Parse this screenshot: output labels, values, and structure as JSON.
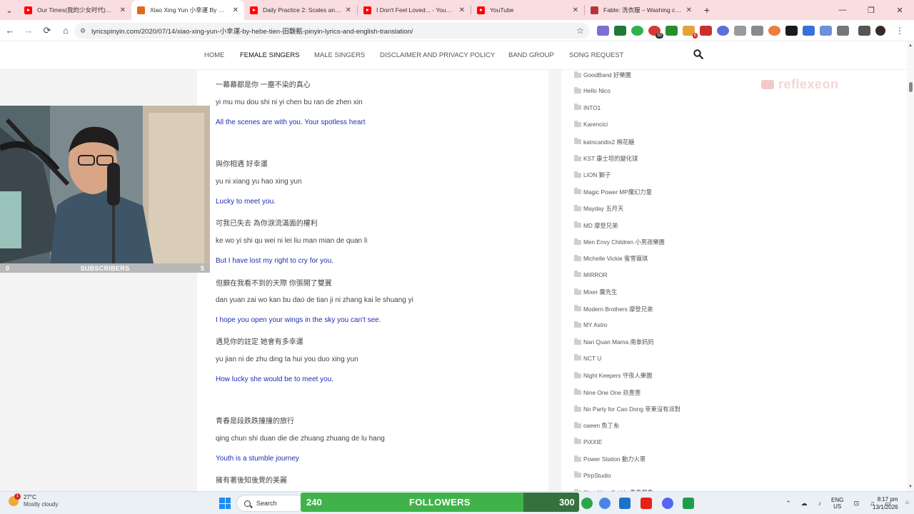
{
  "tabs": [
    {
      "title": "Our Times(我的少女时代)电影",
      "icon": "youtube-icon"
    },
    {
      "title": "Xiao Xing Yun 小幸運 By Hebe",
      "icon": "lyricspinyin-icon"
    },
    {
      "title": "Daily Practice 2: Scales and Inte",
      "icon": "youtube-icon"
    },
    {
      "title": "I Don't Feel Loved... - YouTube",
      "icon": "youtube-icon"
    },
    {
      "title": "YouTube",
      "icon": "youtube-icon"
    },
    {
      "title": "Fable: 洗衣服 – Washing clothe",
      "icon": "fable-icon"
    }
  ],
  "tab_close": "✕",
  "new_tab": "+",
  "window_controls": {
    "minimize": "—",
    "restore": "❐",
    "close": "✕"
  },
  "address": {
    "url": "lyricspinyin.com/2020/07/14/xiao-xing-yun-小幸運-by-hebe-tien-田馥甄-pinyin-lyrics-and-english-translation/"
  },
  "nav_buttons": {
    "back": "←",
    "forward": "→",
    "reload": "⟳",
    "home": "⌂"
  },
  "site_nav": {
    "items": [
      "HOME",
      "FEMALE SINGERS",
      "MALE SINGERS",
      "DISCLAIMER AND PRIVACY POLICY",
      "BAND GROUP",
      "SONG REQUEST"
    ]
  },
  "watermark": "reflexeon",
  "lyrics": [
    {
      "kind": "cn",
      "text": "一幕幕都是你 一塵不染的真心"
    },
    {
      "kind": "py",
      "text": "yi mu mu dou shi ni  yi chen bu ran de zhen xin"
    },
    {
      "kind": "en",
      "text": "All the scenes are with you. Your spotless heart"
    },
    {
      "kind": "cn",
      "text": "與你相遇 好幸運"
    },
    {
      "kind": "py",
      "text": "yu ni xiang yu  hao xing yun"
    },
    {
      "kind": "en",
      "text": "Lucky to meet you."
    },
    {
      "kind": "cn",
      "text": "可我已失去 為你淚流滿面的權利"
    },
    {
      "kind": "py",
      "text": "ke wo yi shi qu  wei ni lei liu man mian de quan li"
    },
    {
      "kind": "en",
      "text": "But I have lost my right to cry for you."
    },
    {
      "kind": "cn",
      "text": "但願在我看不到的天際 你張開了雙翼"
    },
    {
      "kind": "py",
      "text": "dan yuan zai wo kan bu dao de tian ji  ni zhang kai le shuang yi"
    },
    {
      "kind": "en",
      "text": "I hope you open your wings in the sky you can't see."
    },
    {
      "kind": "cn",
      "text": "遇見你的註定 她會有多幸運"
    },
    {
      "kind": "py",
      "text": "yu jian ni de zhu ding  ta hui you duo xing yun"
    },
    {
      "kind": "en",
      "text": "How lucky she would be to meet you."
    },
    {
      "kind": "cn",
      "text": "青春是段跌跌撞撞的旅行"
    },
    {
      "kind": "py",
      "text": "qing chun shi duan die die zhuang zhuang de lu hang"
    },
    {
      "kind": "en",
      "text": "Youth is a stumble journey"
    },
    {
      "kind": "cn",
      "text": "擁有著後知後覺的美麗"
    }
  ],
  "sidebar": {
    "items": [
      "GoodBand 好樂團",
      "Hello Nico",
      "INTO1",
      "Karencici",
      "katncandix2 棉花糖",
      "KST 康士坦的變化球",
      "LION 獅子",
      "Magic Power MP魔幻力量",
      "Mayday 五月天",
      "MD 摩登兄弟",
      "Men Envy Children 小男孩樂團",
      "Michelle Vickie 蜜雪薇琪",
      "MIRROR",
      "Mixer 麋先生",
      "Modern Brothers 摩登兄弟",
      "MY Astro",
      "Nan Quan Mama 南拳妈妈",
      "NCT U",
      "Night Keepers 守夜人樂團",
      "Nine One One 玖壹壹",
      "No Party for Cao Dong 草東沒有派對",
      "oaeen 魚丁糸",
      "PiXXIE",
      "Power Station 動力火車",
      "PtrpStudio",
      "Qing Niao Fei Yu 青鳥飛魚"
    ]
  },
  "webcam": {
    "subscribers_label": "SUBSCRIBERS",
    "subscribers_start": "0",
    "subscribers_goal": "5"
  },
  "taskbar": {
    "weather_temp": "27°C",
    "weather_desc": "Mostly cloudy",
    "weather_badge": "1",
    "search_label": "Search",
    "followers_count": "240",
    "followers_label": "FOLLOWERS",
    "followers_goal": "300",
    "followers_progress": 0.8,
    "lang_top": "ENG",
    "lang_bottom": "US",
    "time": "8:17 pm",
    "date": "13/1/2026"
  },
  "colors": {
    "tabstrip": "#f9dde0",
    "english_lyric": "#1f2fb4",
    "followers_bar": "#3fb34a",
    "taskbar": "#eaf0f6"
  }
}
